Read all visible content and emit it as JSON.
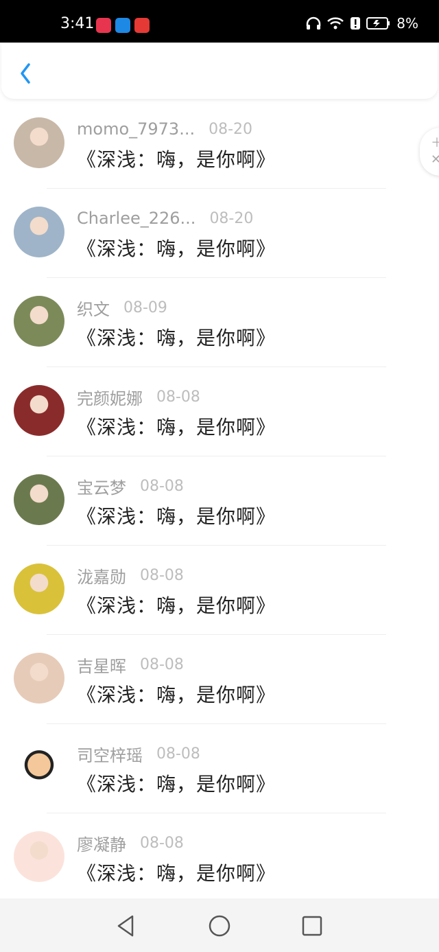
{
  "status_bar": {
    "time": "3:41",
    "battery": "8%",
    "app_icons": [
      "app-red-icon",
      "app-shield-icon",
      "app-red-badge-icon"
    ]
  },
  "header": {
    "back_icon": "chevron-left-icon"
  },
  "colors": {
    "accent": "#2196f3",
    "name_text": "#9e9e9e",
    "date_text": "#bdbdbd",
    "message_text": "#222222"
  },
  "list": {
    "items": [
      {
        "name": "momo_7973...",
        "date": "08-20",
        "message": "《深浅：嗨，是你啊》",
        "avatar_color": "#c8b8a8"
      },
      {
        "name": "Charlee_226...",
        "date": "08-20",
        "message": "《深浅：嗨，是你啊》",
        "avatar_color": "#9fb4c8"
      },
      {
        "name": "织文",
        "date": "08-09",
        "message": "《深浅：嗨，是你啊》",
        "avatar_color": "#7c8a5a"
      },
      {
        "name": "完颜妮娜",
        "date": "08-08",
        "message": "《深浅：嗨，是你啊》",
        "avatar_color": "#8a2b2b"
      },
      {
        "name": "宝云梦",
        "date": "08-08",
        "message": "《深浅：嗨，是你啊》",
        "avatar_color": "#6b7a4e"
      },
      {
        "name": "泷嘉勋",
        "date": "08-08",
        "message": "《深浅：嗨，是你啊》",
        "avatar_color": "#d9c23a"
      },
      {
        "name": "吉星晖",
        "date": "08-08",
        "message": "《深浅：嗨，是你啊》",
        "avatar_color": "#e6cbb8"
      },
      {
        "name": "司空梓瑶",
        "date": "08-08",
        "message": "《深浅：嗨，是你啊》",
        "avatar_color": "#ffffff"
      },
      {
        "name": "廖凝静",
        "date": "08-08",
        "message": "《深浅：嗨，是你啊》",
        "avatar_color": "#fbe3dc"
      }
    ]
  },
  "nav_bar": {
    "back_icon": "triangle-back-icon",
    "home_icon": "circle-home-icon",
    "recents_icon": "square-recents-icon"
  }
}
